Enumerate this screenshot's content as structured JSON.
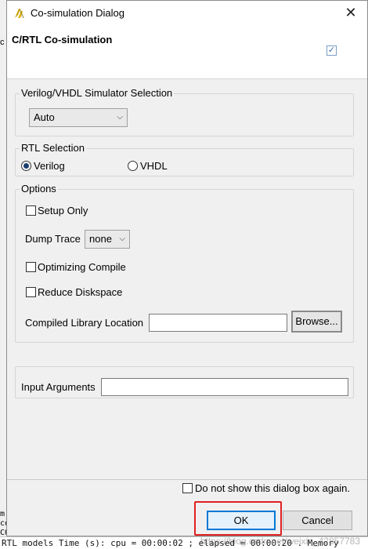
{
  "background": {
    "left_fragment": "c",
    "console_side": [
      "m",
      "co",
      "CO"
    ],
    "console_text": "RTL models Time (s): cpu = 00:00:02 ; elapsed = 00:00:20 . Memory",
    "watermark": "https://blog.csdn.net/weixin_42857783"
  },
  "window": {
    "title": "Co-simulation Dialog",
    "close_symbol": "✕"
  },
  "header": {
    "title": "C/RTL Co-simulation",
    "checked": true
  },
  "simulator": {
    "legend": "Verilog/VHDL Simulator Selection",
    "selected": "Auto"
  },
  "rtl": {
    "legend": "RTL Selection",
    "options": [
      "Verilog",
      "VHDL"
    ],
    "selected": "Verilog"
  },
  "options": {
    "legend": "Options",
    "setup_only": "Setup Only",
    "dump_trace_label": "Dump Trace",
    "dump_trace_value": "none",
    "optimizing_compile": "Optimizing Compile",
    "reduce_diskspace": "Reduce Diskspace",
    "compiled_library_label": "Compiled Library Location",
    "compiled_library_value": "",
    "browse_button": "Browse..."
  },
  "input_arguments": {
    "label": "Input Arguments",
    "value": ""
  },
  "footer": {
    "dont_show": "Do not show this dialog box again.",
    "ok": "OK",
    "cancel": "Cancel"
  },
  "colors": {
    "highlight": "#e02020",
    "accent": "#0078d7",
    "dialog_bg": "#f0f0f0"
  }
}
